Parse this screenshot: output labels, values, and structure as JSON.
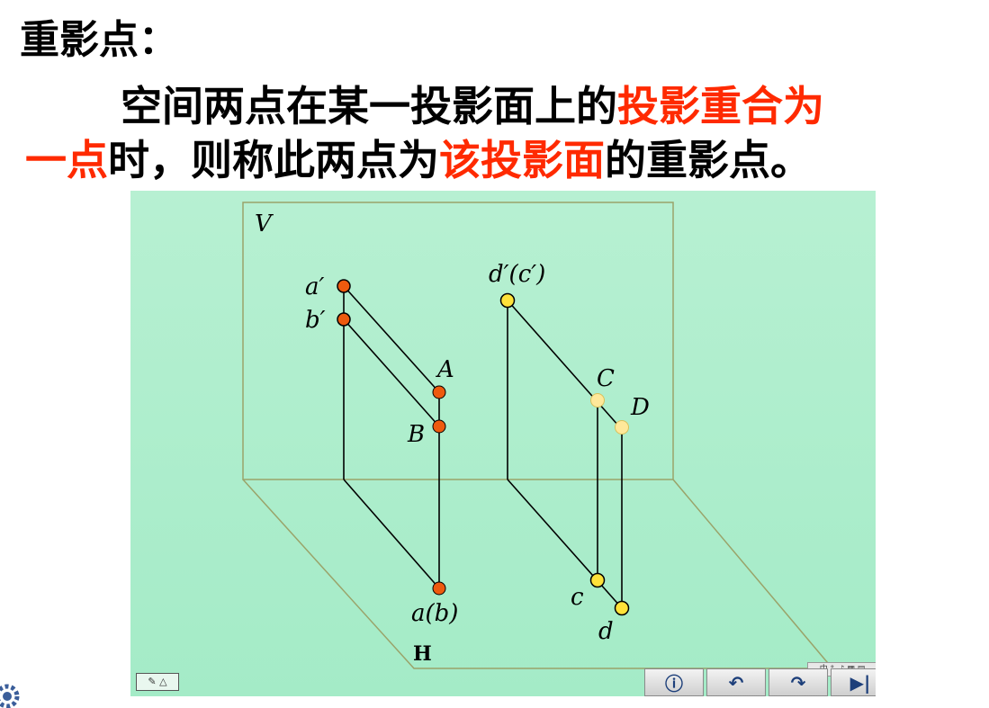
{
  "title": "重影点：",
  "paragraph": {
    "line1_black": "空间两点在某一投影面上的",
    "line1_red": "投影重合为",
    "line2_red_a": "一点",
    "line2_black_a": "时，则称此两点为",
    "line2_red_b": "该投影面",
    "line2_black_b": "的重影点。"
  },
  "diagram": {
    "plane_v_label": "V",
    "plane_h_label": "H",
    "points": {
      "a_prime": "a′",
      "b_prime": "b′",
      "A": "A",
      "B": "B",
      "ab": "a(b)",
      "dc_prime": "d′(c′)",
      "C": "C",
      "D": "D",
      "c": "c",
      "d": "d"
    },
    "colors": {
      "background": "#a8edc9",
      "plane_border": "#9aa36a",
      "line": "#000000",
      "point_orange": "#ee5a0e",
      "point_yellow": "#ffe23a",
      "point_light_yellow": "#ffe89a",
      "emphasis_red": "#ff2a00"
    }
  },
  "toolbar": {
    "info_icon": "info-icon",
    "back_icon": "return-icon",
    "up_icon": "turn-icon",
    "end_icon": "skip-end-icon"
  }
}
